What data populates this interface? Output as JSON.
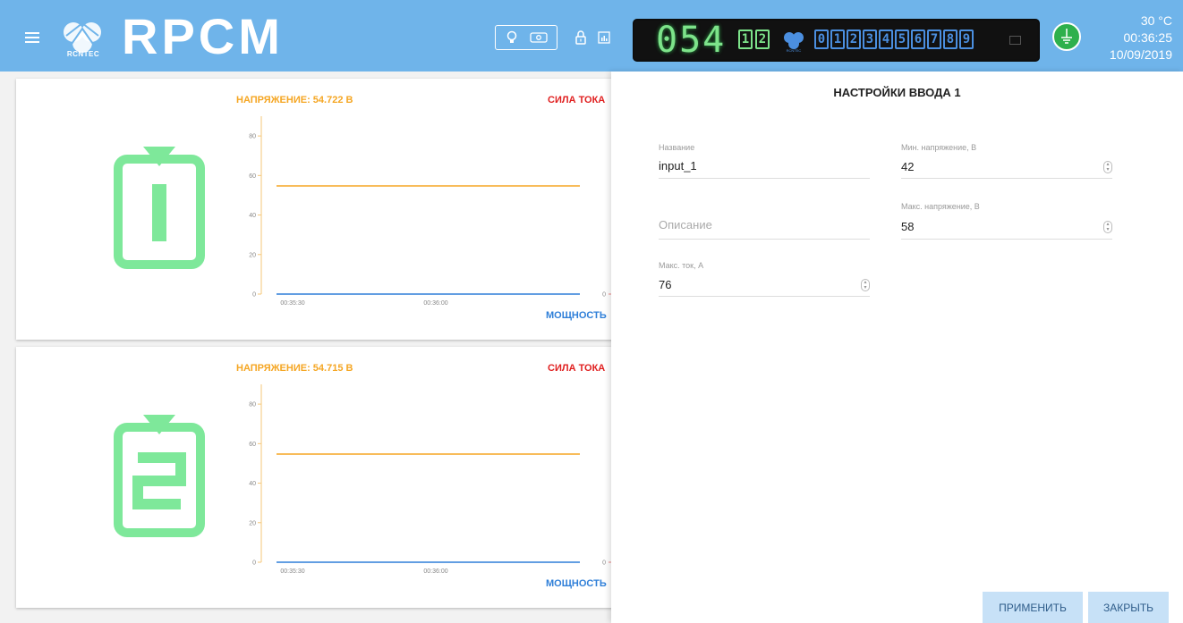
{
  "header": {
    "logo_text": "RPCM",
    "logo_small": "RCNTEC",
    "display": {
      "number": "054",
      "pair": [
        "1",
        "2"
      ],
      "boxes": [
        "0",
        "1",
        "2",
        "3",
        "4",
        "5",
        "6",
        "7",
        "8",
        "9"
      ]
    },
    "temperature": "30 °C",
    "time": "00:36:25",
    "date": "10/09/2019"
  },
  "cards": [
    {
      "voltage_label": "НАПРЯЖЕНИЕ: 54.722 В",
      "current_label": "СИЛА ТОКА",
      "power_label": "МОЩНОСТЬ",
      "icon_number": "1"
    },
    {
      "voltage_label": "НАПРЯЖЕНИЕ: 54.715 В",
      "current_label": "СИЛА ТОКА",
      "power_label": "МОЩНОСТЬ",
      "icon_number": "2"
    }
  ],
  "chart_data": [
    {
      "type": "line",
      "xlabel": "",
      "ylabel": "",
      "x_ticks": [
        "00:35:30",
        "00:36:00"
      ],
      "y_ticks": [
        0,
        20,
        40,
        60,
        80
      ],
      "right_ticks": [
        0
      ],
      "ylim": [
        0,
        90
      ],
      "series": [
        {
          "name": "НАПРЯЖЕНИЕ",
          "color": "#f5a623",
          "values": [
            54.722,
            54.722
          ]
        },
        {
          "name": "МОЩНОСТЬ",
          "color": "#2f7fd8",
          "values": [
            0,
            0
          ]
        }
      ]
    },
    {
      "type": "line",
      "xlabel": "",
      "ylabel": "",
      "x_ticks": [
        "00:35:30",
        "00:36:00"
      ],
      "y_ticks": [
        0,
        20,
        40,
        60,
        80
      ],
      "right_ticks": [
        0
      ],
      "ylim": [
        0,
        90
      ],
      "series": [
        {
          "name": "НАПРЯЖЕНИЕ",
          "color": "#f5a623",
          "values": [
            54.715,
            54.715
          ]
        },
        {
          "name": "МОЩНОСТЬ",
          "color": "#2f7fd8",
          "values": [
            0,
            0
          ]
        }
      ]
    }
  ],
  "panel": {
    "title": "НАСТРОЙКИ ВВОДА 1",
    "name_label": "Название",
    "name_value": "input_1",
    "desc_placeholder": "Описание",
    "max_current_label": "Макс. ток, А",
    "max_current_value": "76",
    "min_voltage_label": "Мин. напряжение, В",
    "min_voltage_value": "42",
    "max_voltage_label": "Макс. напряжение, В",
    "max_voltage_value": "58",
    "apply_label": "ПРИМЕНИТЬ",
    "close_label": "ЗАКРЫТЬ"
  },
  "colors": {
    "header_bg": "#6fb4ea",
    "voltage": "#f5a623",
    "current": "#e02020",
    "power": "#2f7fd8",
    "icon_green": "#7ee89a",
    "display_green": "#7de38a"
  }
}
